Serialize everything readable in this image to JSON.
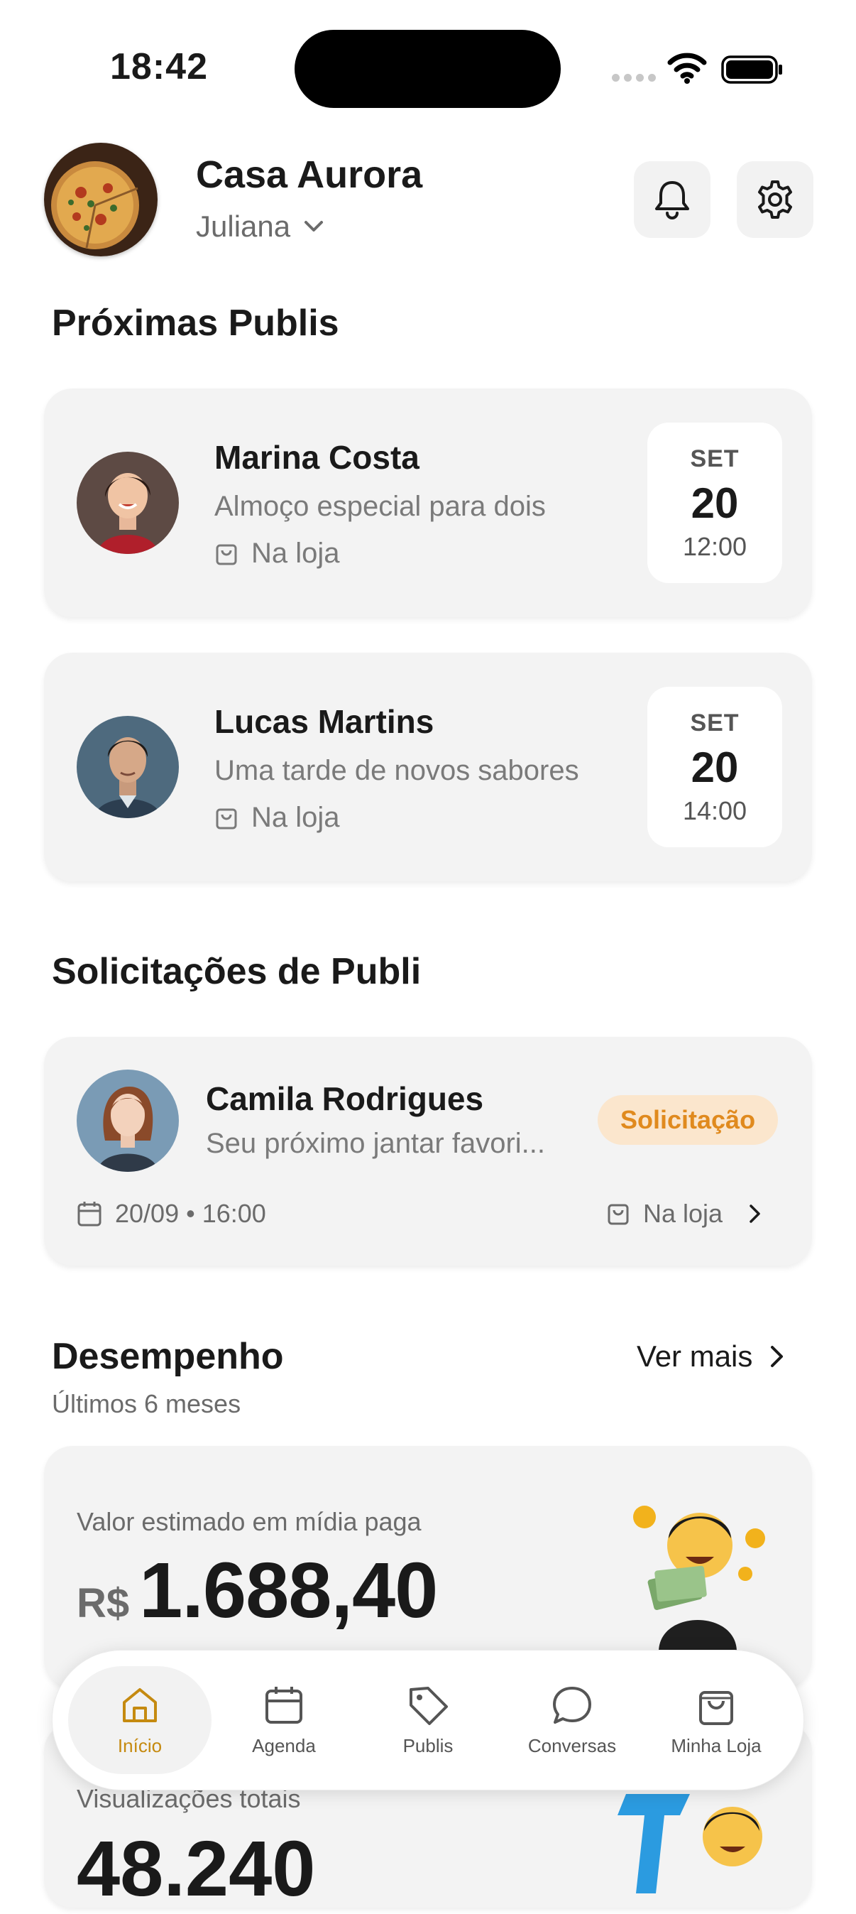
{
  "status_bar": {
    "time": "18:42"
  },
  "header": {
    "store_name": "Casa Aurora",
    "user_name": "Juliana"
  },
  "upcoming": {
    "title": "Próximas Publis",
    "items": [
      {
        "name": "Marina Costa",
        "description": "Almoço especial para dois",
        "location": "Na loja",
        "month": "SET",
        "day": "20",
        "time": "12:00"
      },
      {
        "name": "Lucas Martins",
        "description": "Uma tarde de novos sabores",
        "location": "Na loja",
        "month": "SET",
        "day": "20",
        "time": "14:00"
      }
    ]
  },
  "requests": {
    "title": "Solicitações de Publi",
    "items": [
      {
        "name": "Camila Rodrigues",
        "description": "Seu próximo jantar favori...",
        "badge": "Solicitação",
        "date": "20/09",
        "time": "16:00",
        "location": "Na loja"
      }
    ]
  },
  "performance": {
    "title": "Desempenho",
    "subtitle": "Últimos 6 meses",
    "see_more": "Ver mais",
    "paid_media": {
      "label": "Valor estimado em mídia paga",
      "currency": "R$",
      "value": "1.688,40"
    },
    "views": {
      "label": "Visualizações totais",
      "value": "48.240"
    }
  },
  "nav": {
    "items": [
      {
        "label": "Início",
        "icon": "home-icon",
        "active": true
      },
      {
        "label": "Agenda",
        "icon": "calendar-icon",
        "active": false
      },
      {
        "label": "Publis",
        "icon": "tag-icon",
        "active": false
      },
      {
        "label": "Conversas",
        "icon": "chat-icon",
        "active": false
      },
      {
        "label": "Minha Loja",
        "icon": "bag-icon",
        "active": false
      }
    ]
  },
  "colors": {
    "accent": "#C58A10",
    "badge_bg": "#FBE6CD",
    "badge_text": "#E08A1E",
    "card_bg": "#F3F3F3"
  }
}
